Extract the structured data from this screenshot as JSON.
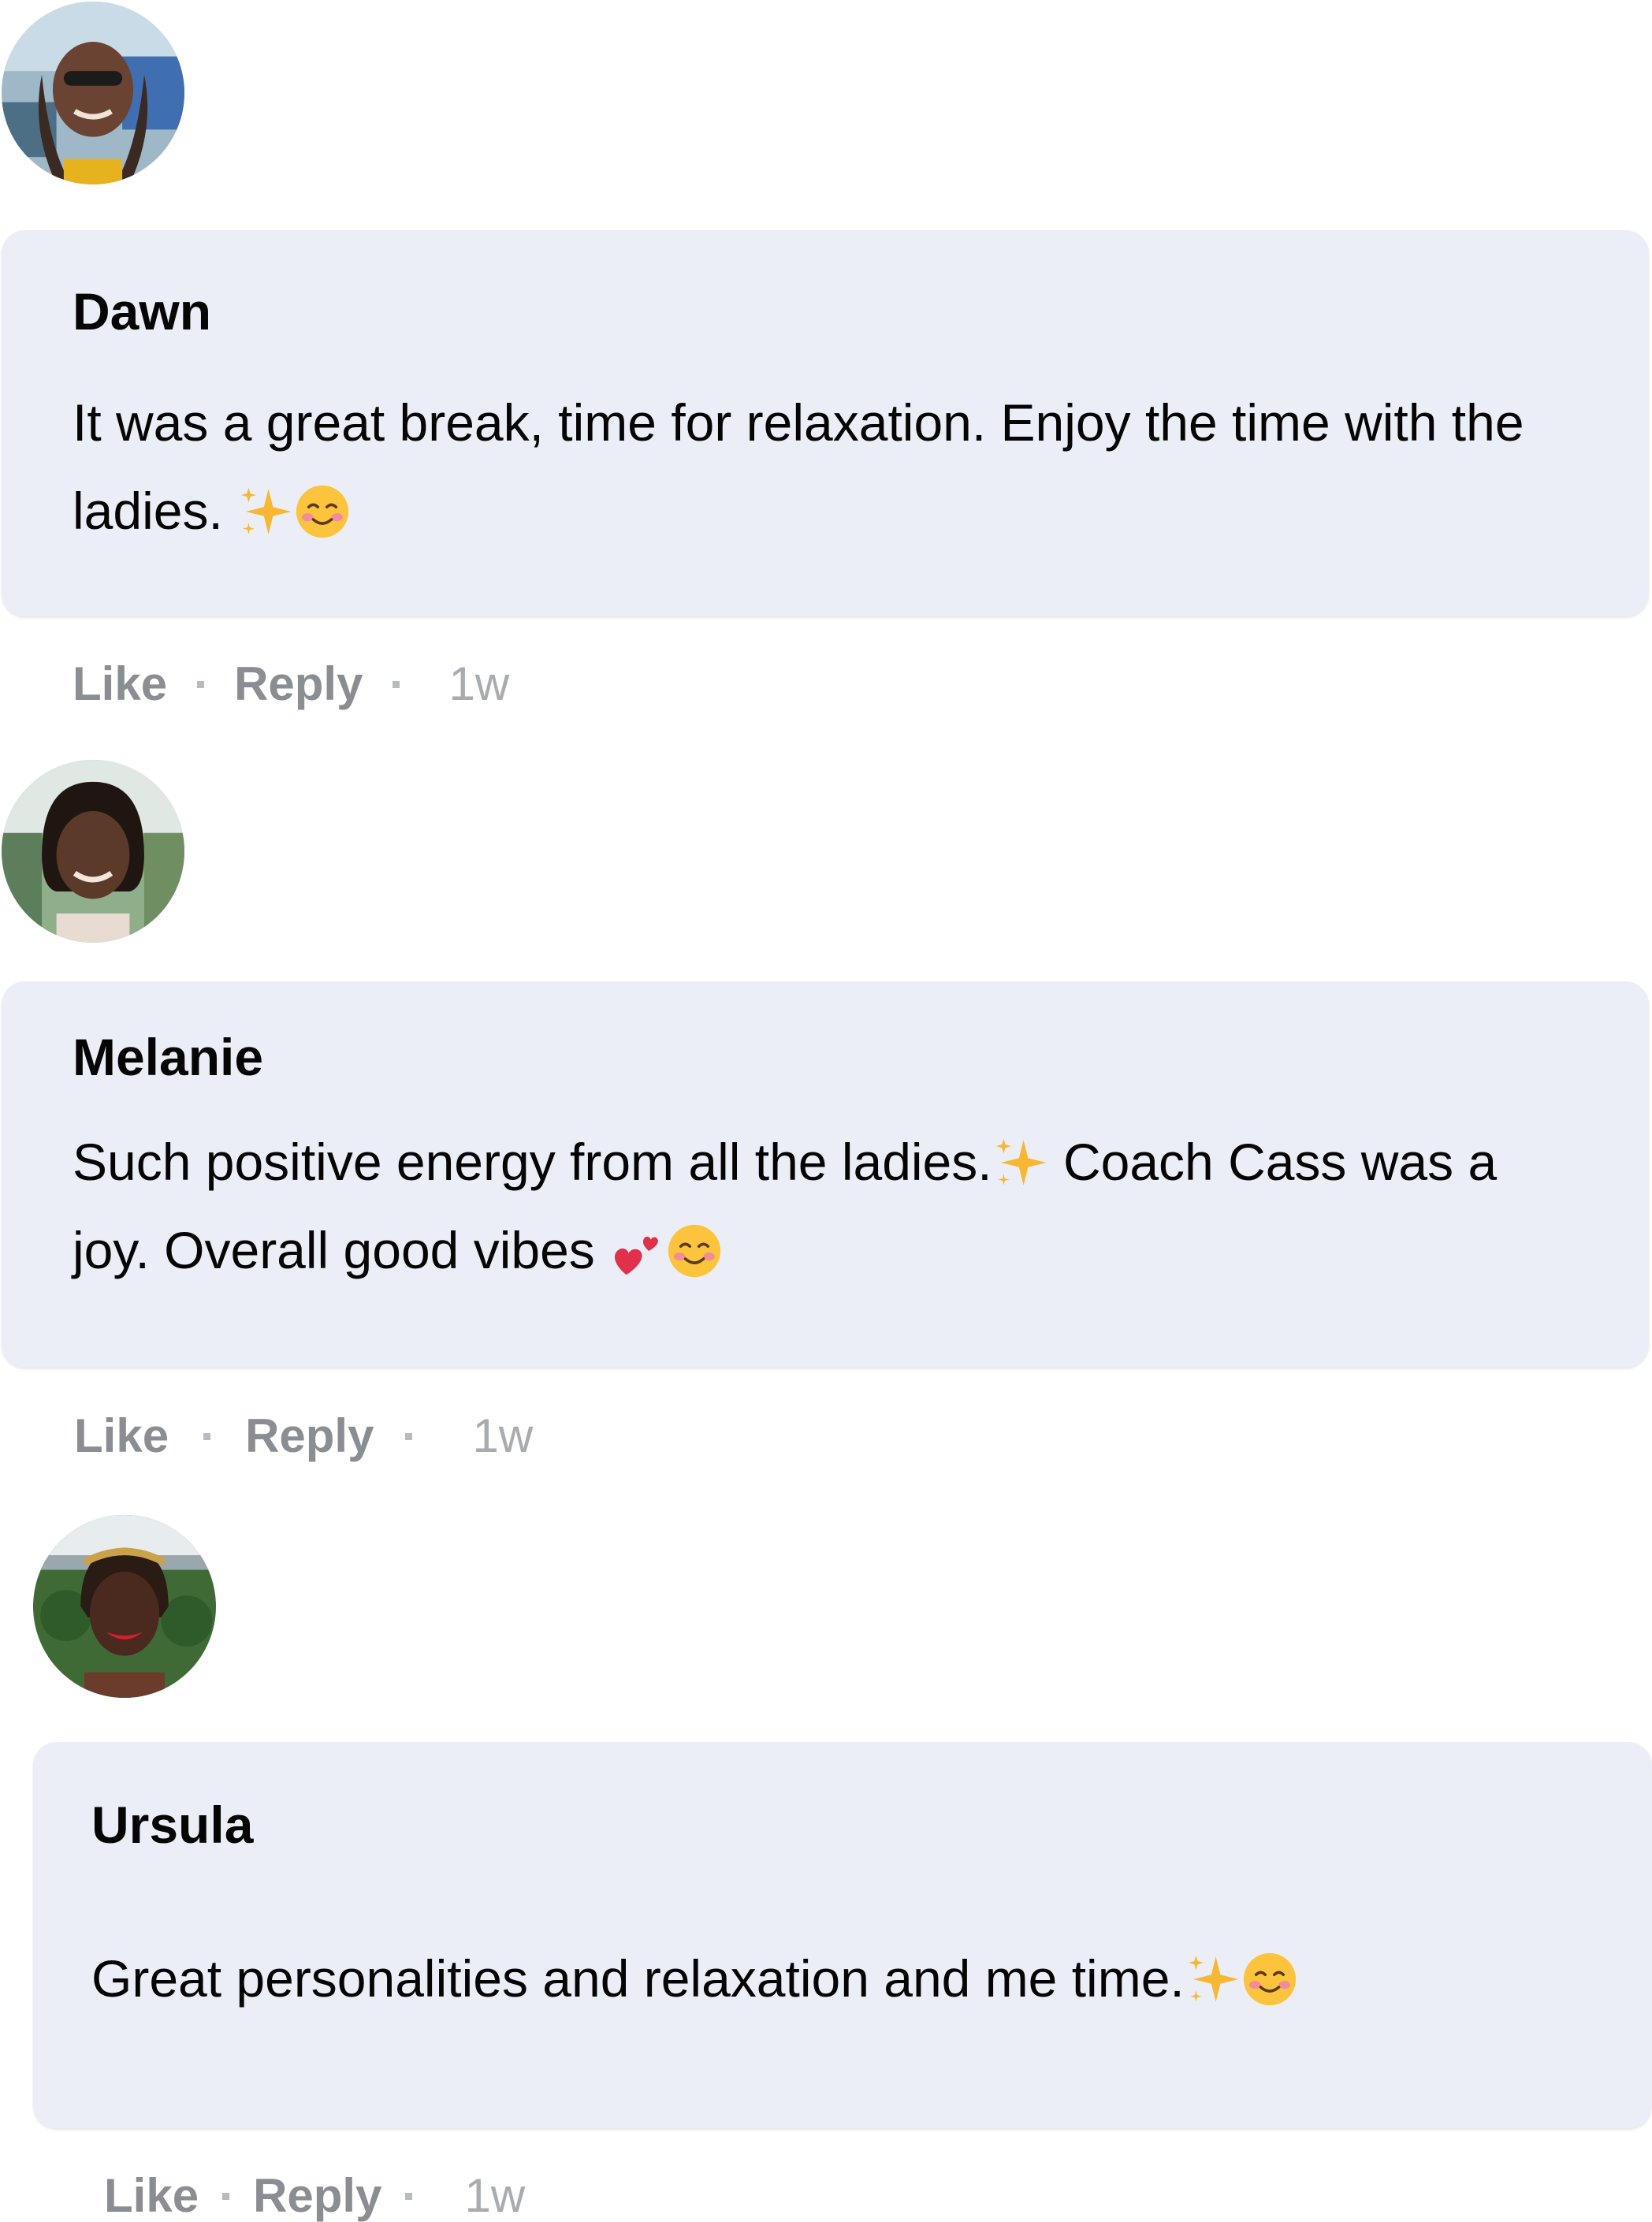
{
  "comments": [
    {
      "author": "Dawn",
      "text": "It was a great break, time for relaxation. Enjoy the time with the ladies. ",
      "emojis": [
        "sparkles-icon",
        "smiling-face-icon"
      ],
      "actions": {
        "like": "Like",
        "reply": "Reply",
        "time": "1w"
      }
    },
    {
      "author": "Melanie",
      "text_part1": "Such positive energy from all the ladies.",
      "text_part2": " Coach Cass was a joy. Overall good vibes ",
      "emojis": [
        "sparkles-icon",
        "two-hearts-icon",
        "smiling-face-icon"
      ],
      "actions": {
        "like": "Like",
        "reply": "Reply",
        "time": "1w"
      }
    },
    {
      "author": "Ursula",
      "text": "Great personalities and relaxation and me time.",
      "emojis": [
        "sparkles-icon",
        "smiling-face-icon"
      ],
      "actions": {
        "like": "Like",
        "reply": "Reply",
        "time": "1w"
      }
    }
  ],
  "colors": {
    "bubble": "#eceef7",
    "action_text": "#8a8d91",
    "timestamp": "#a8abaf"
  }
}
